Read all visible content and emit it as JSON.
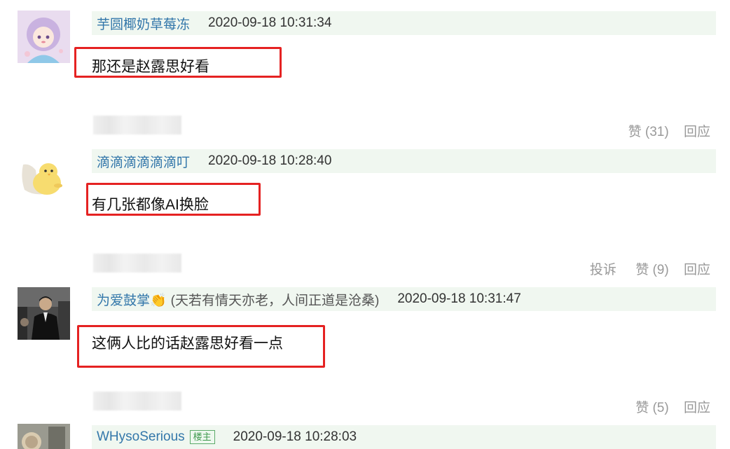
{
  "comments": [
    {
      "author": "芋圆椰奶草莓冻",
      "signature": "",
      "timestamp": "2020-09-18 10:31:34",
      "content": "那还是赵露思好看",
      "avatar_icon": "anime-girl-avatar"
    },
    {
      "author": "滴滴滴滴滴滴叮",
      "signature": "",
      "timestamp": "2020-09-18 10:28:40",
      "content": "有几张都像AI换脸",
      "avatar_icon": "yellow-chick-avatar"
    },
    {
      "author": "为爱鼓掌👏",
      "signature": "(天若有情天亦老，人间正道是沧桑)",
      "timestamp": "2020-09-18 10:31:47",
      "content": "这俩人比的话赵露思好看一点",
      "avatar_icon": "man-in-suit-avatar"
    },
    {
      "author": "WHysoSerious",
      "badge": "楼主",
      "timestamp": "2020-09-18 10:28:03",
      "avatar_icon": "photo-avatar"
    }
  ],
  "actions": [
    {
      "like": "赞 (31)",
      "reply": "回应"
    },
    {
      "report": "投诉",
      "like": "赞 (9)",
      "reply": "回应"
    },
    {
      "like": "赞 (5)",
      "reply": "回应"
    }
  ],
  "colors": {
    "highlight_box": "#e52222",
    "author_link": "#3377aa",
    "header_bar": "#f0f7f0",
    "muted": "#999999",
    "owner_badge": "#3f9a4f"
  }
}
